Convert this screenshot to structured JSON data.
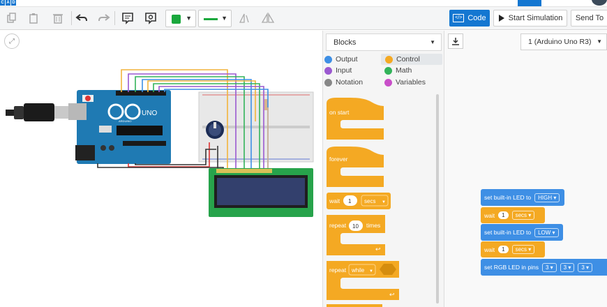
{
  "app": {
    "logo": [
      "C",
      "A",
      "D"
    ]
  },
  "toolbar": {
    "code_label": "Code",
    "start_simulation_label": "Start Simulation",
    "send_to_label": "Send To",
    "icons": [
      "copy-icon",
      "paste-icon",
      "delete-icon",
      "undo-icon",
      "redo-icon",
      "note-icon",
      "visibility-icon",
      "color-swatch",
      "line-style",
      "mirror-icon",
      "flip-icon"
    ],
    "color": "#1aa83d"
  },
  "blocks_panel": {
    "dropdown_value": "Blocks",
    "categories": [
      {
        "label": "Output",
        "color": "#3e8fe5"
      },
      {
        "label": "Control",
        "color": "#f4a923"
      },
      {
        "label": "Input",
        "color": "#9b59d0"
      },
      {
        "label": "Math",
        "color": "#33b35a"
      },
      {
        "label": "Notation",
        "color": "#888888"
      },
      {
        "label": "Variables",
        "color": "#c94fc9"
      }
    ],
    "palette": {
      "on_start": "on start",
      "forever": "forever",
      "wait": "wait",
      "wait_value": "1",
      "wait_unit": "secs",
      "repeat": "repeat",
      "repeat_value": "10",
      "times": "times",
      "repeat_while": "repeat",
      "while": "while"
    }
  },
  "code_panel": {
    "board_select": "1 (Arduino Uno R3)",
    "script": {
      "line1": "set built-in LED to",
      "line1_value": "HIGH",
      "line2": "wait",
      "line2_value": "1",
      "line2_unit": "secs",
      "line3": "set built-in LED to",
      "line3_value": "LOW",
      "line4": "wait",
      "line4_value": "1",
      "line4_unit": "secs",
      "line5": "set RGB LED in pins",
      "line5_values": [
        "3",
        "3",
        "3"
      ]
    }
  },
  "circuit": {
    "board_label": "UNO",
    "board_brand": "ARDUINO",
    "lcd_text": ""
  }
}
